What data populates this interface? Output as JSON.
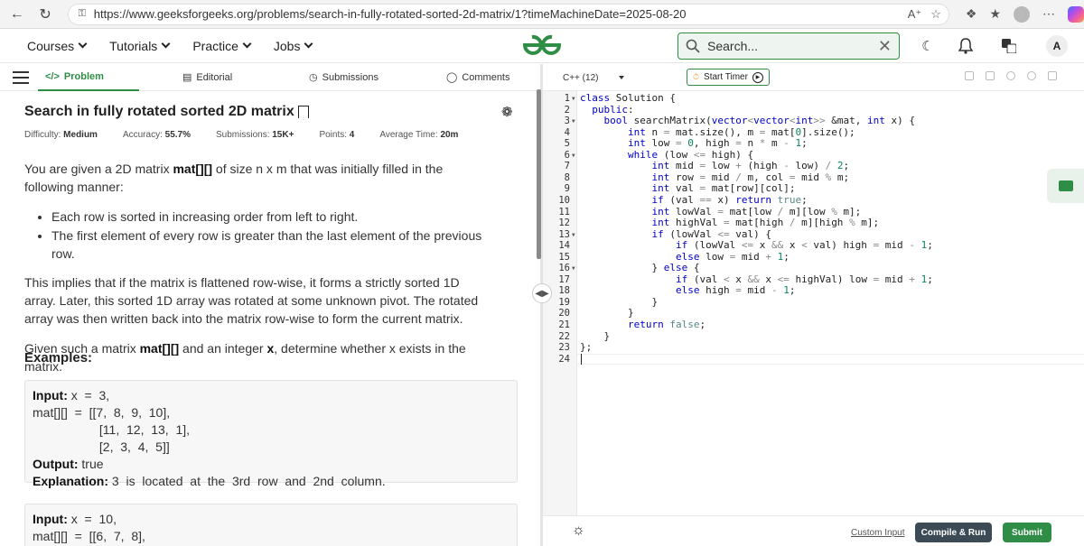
{
  "browser": {
    "url": "https://www.geeksforgeeks.org/problems/search-in-fully-rotated-sorted-2d-matrix/1?timeMachineDate=2025-08-20"
  },
  "site": {
    "nav": [
      "Courses",
      "Tutorials",
      "Practice",
      "Jobs"
    ],
    "search_placeholder": "Search...",
    "avatar_letter": "A",
    "brand_color": "#2f8d46"
  },
  "tabs": {
    "problem": "Problem",
    "editorial": "Editorial",
    "submissions": "Submissions",
    "comments": "Comments"
  },
  "problem": {
    "title": "Search in fully rotated sorted 2D matrix",
    "meta": {
      "difficulty_label": "Difficulty:",
      "difficulty": "Medium",
      "accuracy_label": "Accuracy:",
      "accuracy": "55.7%",
      "submissions_label": "Submissions:",
      "submissions": "15K+",
      "points_label": "Points:",
      "points": "4",
      "time_label": "Average Time:",
      "time": "20m"
    },
    "desc_p1_a": "You are given a 2D matrix ",
    "desc_p1_b": "mat[][]",
    "desc_p1_c": " of size n x m that was initially filled in the following manner:",
    "bullets": [
      "Each row is sorted in increasing order from left to right.",
      "The first element of every row is greater than the last element of the previous row."
    ],
    "desc_p2": "This implies that if the matrix is flattened row-wise, it forms a strictly sorted 1D array. Later, this sorted 1D array was rotated at some unknown pivot. The rotated array was then written back into the matrix row-wise to form the current matrix.",
    "desc_p3_a": "Given such a matrix ",
    "desc_p3_b": "mat[][]",
    "desc_p3_c": " and an integer ",
    "desc_p3_d": "x",
    "desc_p3_e": ", determine whether x exists in the matrix.",
    "examples_title": "Examples:",
    "example1": {
      "input_label": "Input:",
      "input_line1": " x  =  3,",
      "input_line2": "mat[][]  =  [[7,  8,  9,  10],",
      "input_line3": "                   [11,  12,  13,  1],",
      "input_line4": "                   [2,  3,  4,  5]]",
      "output_label": "Output:",
      "output": " true",
      "expl_label": "Explanation:",
      "expl": " 3  is  located  at  the  3rd  row  and  2nd  column."
    },
    "example2": {
      "input_label": "Input:",
      "input_line1": " x  =  10,",
      "input_line2": "mat[][]  =  [[6,  7,  8],"
    }
  },
  "editor": {
    "language": "C++ (12)",
    "start_timer": "Start Timer",
    "custom_input": "Custom Input",
    "compile_run": "Compile & Run",
    "submit": "Submit",
    "line_numbers": [
      "1",
      "2",
      "3",
      "4",
      "5",
      "6",
      "7",
      "8",
      "9",
      "10",
      "11",
      "12",
      "13",
      "14",
      "15",
      "16",
      "17",
      "18",
      "19",
      "20",
      "21",
      "22",
      "23",
      "24"
    ],
    "folds": [
      1,
      3,
      6,
      13,
      16
    ],
    "code": [
      "class Solution {",
      "  public:",
      "    bool searchMatrix(vector<vector<int>> &mat, int x) {",
      "        int n = mat.size(), m = mat[0].size();",
      "        int low = 0, high = n * m - 1;",
      "        while (low <= high) {",
      "            int mid = low + (high - low) / 2;",
      "            int row = mid / m, col = mid % m;",
      "            int val = mat[row][col];",
      "            if (val == x) return true;",
      "            int lowVal = mat[low / m][low % m];",
      "            int highVal = mat[high / m][high % m];",
      "            if (lowVal <= val) {",
      "                if (lowVal <= x && x < val) high = mid - 1;",
      "                else low = mid + 1;",
      "            } else {",
      "                if (val < x && x <= highVal) low = mid + 1;",
      "                else high = mid - 1;",
      "            }",
      "        }",
      "        return false;",
      "    }",
      "};",
      ""
    ]
  }
}
